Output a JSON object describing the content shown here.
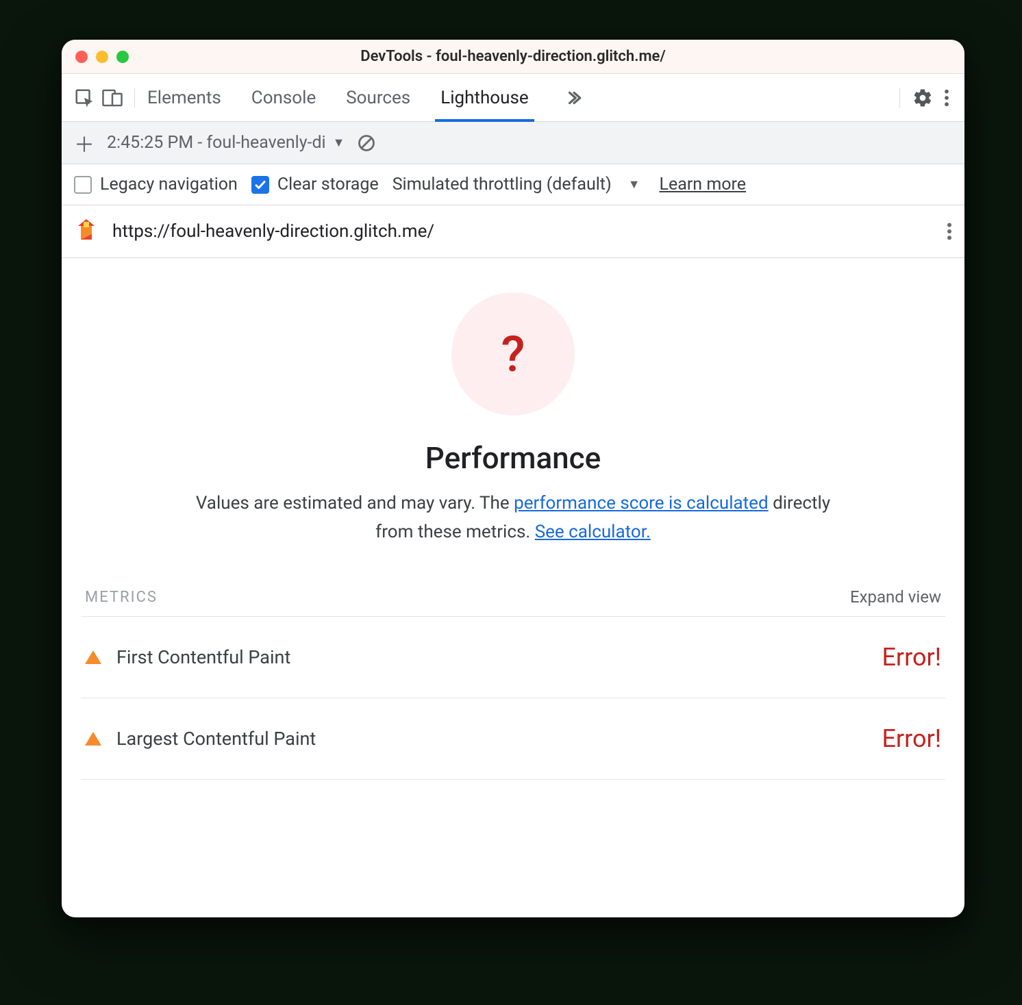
{
  "window": {
    "title": "DevTools - foul-heavenly-direction.glitch.me/"
  },
  "tabs": {
    "items": [
      "Elements",
      "Console",
      "Sources",
      "Lighthouse"
    ],
    "active": "Lighthouse"
  },
  "subbar": {
    "run_label": "2:45:25 PM - foul-heavenly-di"
  },
  "options": {
    "legacy_label": "Legacy navigation",
    "legacy_checked": false,
    "clear_label": "Clear storage",
    "clear_checked": true,
    "throttling_label": "Simulated throttling (default)",
    "learn_more": "Learn more"
  },
  "report": {
    "url": "https://foul-heavenly-direction.glitch.me/",
    "score_symbol": "?",
    "category": "Performance",
    "desc_prefix": "Values are estimated and may vary. The ",
    "desc_link1": "performance score is calculated",
    "desc_mid": " directly from these metrics. ",
    "desc_link2": "See calculator.",
    "metrics_heading": "METRICS",
    "expand_label": "Expand view",
    "metrics": [
      {
        "name": "First Contentful Paint",
        "value": "Error!"
      },
      {
        "name": "Largest Contentful Paint",
        "value": "Error!"
      }
    ]
  }
}
